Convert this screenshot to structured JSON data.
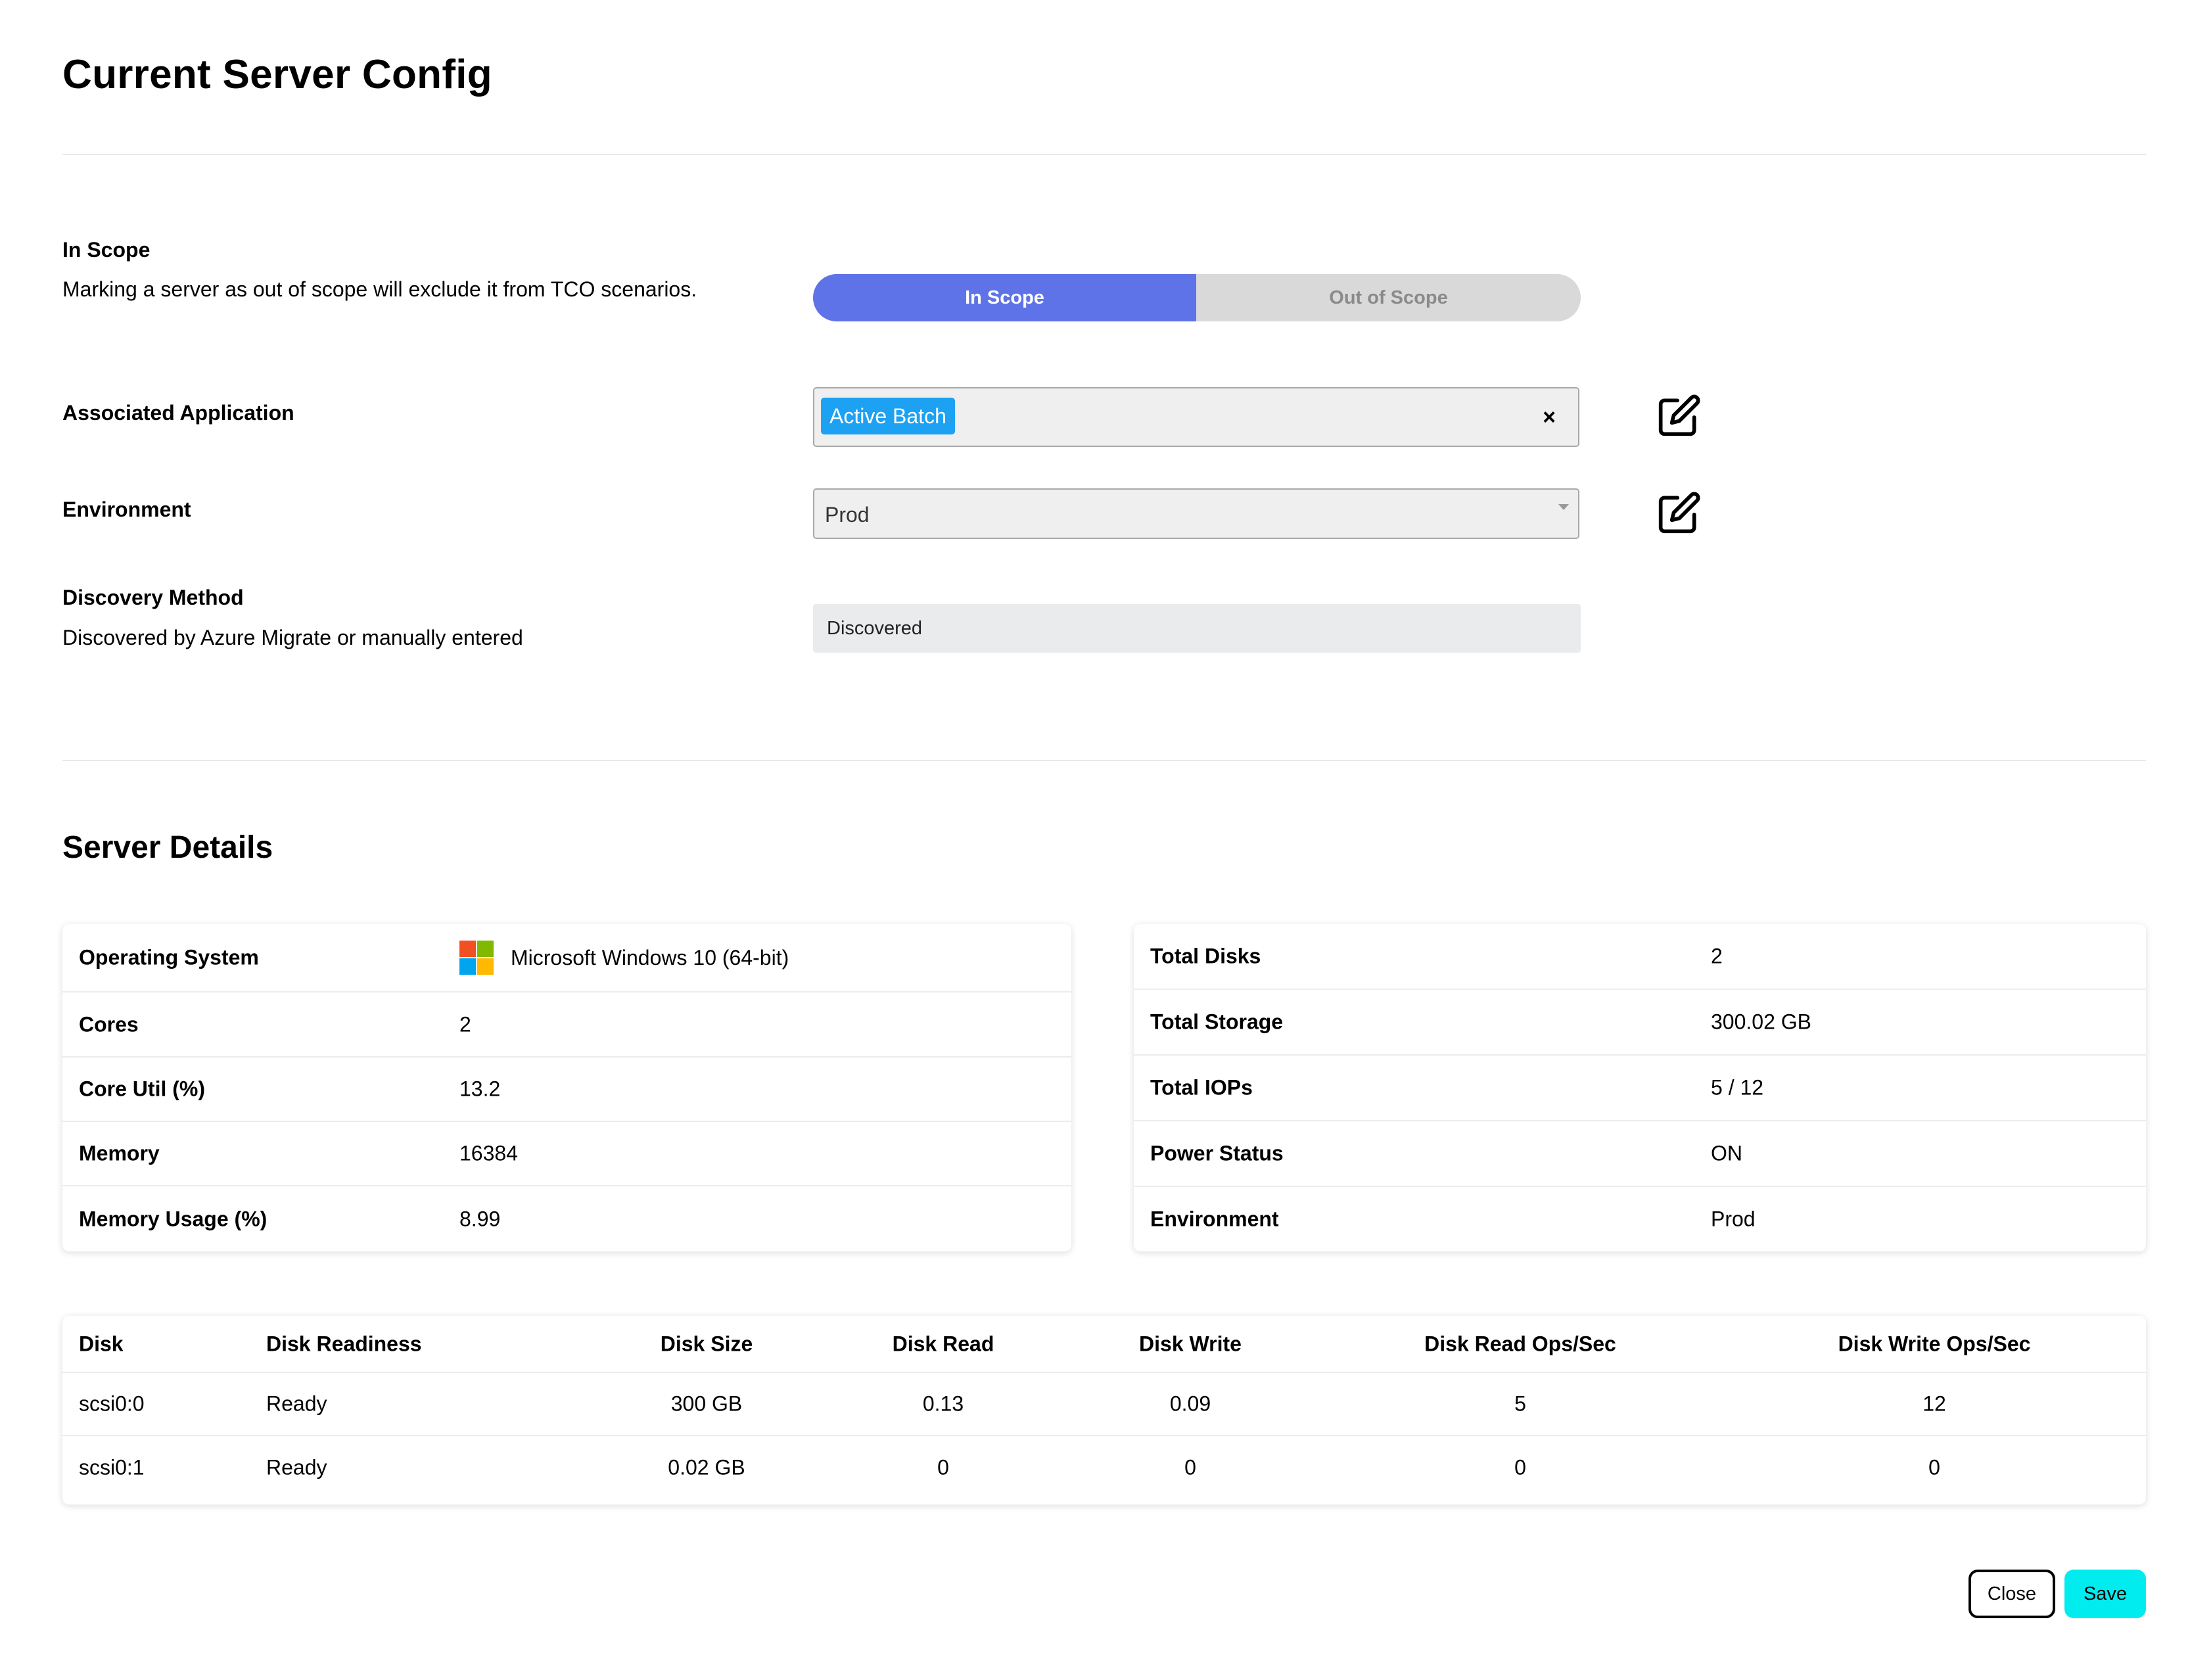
{
  "page_title": "Current Server Config",
  "scope": {
    "label": "In Scope",
    "description": "Marking a server as out of scope will exclude it from TCO scenarios.",
    "options": [
      "In Scope",
      "Out of Scope"
    ],
    "selected": "In Scope"
  },
  "associated_application": {
    "label": "Associated Application",
    "tags": [
      "Active Batch"
    ],
    "clear_glyph": "×"
  },
  "environment_field": {
    "label": "Environment",
    "value": "Prod"
  },
  "discovery_method": {
    "label": "Discovery Method",
    "description": "Discovered by Azure Migrate or manually entered",
    "value": "Discovered"
  },
  "server_details": {
    "title": "Server Details",
    "left": [
      {
        "key": "Operating System",
        "value": "Microsoft Windows 10 (64-bit)",
        "icon": "windows-logo-icon"
      },
      {
        "key": "Cores",
        "value": "2"
      },
      {
        "key": "Core Util (%)",
        "value": "13.2"
      },
      {
        "key": "Memory",
        "value": "16384"
      },
      {
        "key": "Memory Usage (%)",
        "value": "8.99"
      }
    ],
    "right": [
      {
        "key": "Total Disks",
        "value": "2"
      },
      {
        "key": "Total Storage",
        "value": "300.02 GB"
      },
      {
        "key": "Total IOPs",
        "value": "5 / 12"
      },
      {
        "key": "Power Status",
        "value": "ON"
      },
      {
        "key": "Environment",
        "value": "Prod"
      }
    ]
  },
  "disk_table": {
    "columns": [
      "Disk",
      "Disk Readiness",
      "Disk Size",
      "Disk Read",
      "Disk Write",
      "Disk Read Ops/Sec",
      "Disk Write Ops/Sec"
    ],
    "rows": [
      [
        "scsi0:0",
        "Ready",
        "300 GB",
        "0.13",
        "0.09",
        "5",
        "12"
      ],
      [
        "scsi0:1",
        "Ready",
        "0.02 GB",
        "0",
        "0",
        "0",
        "0"
      ]
    ]
  },
  "footer": {
    "close_label": "Close",
    "save_label": "Save"
  },
  "colors": {
    "toggle_active": "#5f73e8",
    "tag_bg": "#1da1f2",
    "save_bg": "#00ecef"
  }
}
